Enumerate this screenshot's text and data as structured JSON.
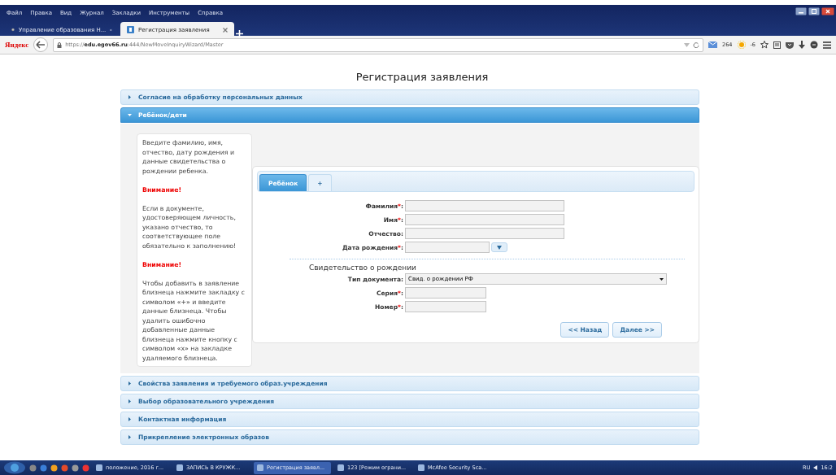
{
  "browser": {
    "menu": [
      "Файл",
      "Правка",
      "Вид",
      "Журнал",
      "Закладки",
      "Инструменты",
      "Справка"
    ],
    "tabs": [
      {
        "label": "Управление образования Н...",
        "selected": false
      },
      {
        "label": "Регистрация заявления",
        "selected": true
      }
    ],
    "brand": "Яндекс",
    "url": "https://**edu.egov66.ru**:444/NewMoveInquiryWizard/Master",
    "mail_count": "264",
    "weather": "-6"
  },
  "page": {
    "title": "Регистрация заявления",
    "sections": [
      {
        "title": "Согласие на обработку персональных данных",
        "expanded": false
      },
      {
        "title": "Ребёнок/дети",
        "expanded": true
      },
      {
        "title": "Свойства заявления и требуемого образ.учреждения",
        "expanded": false
      },
      {
        "title": "Выбор образовательного учреждения",
        "expanded": false
      },
      {
        "title": "Контактная информация",
        "expanded": false
      },
      {
        "title": "Прикрепление электронных образов",
        "expanded": false
      }
    ],
    "hint": [
      {
        "kind": "text",
        "text": "Введите фамилию, имя, отчество, дату рождения и данные свидетельства о рождении ребенка."
      },
      {
        "kind": "warning",
        "text": "Внимание!"
      },
      {
        "kind": "text",
        "text": "Если в документе, удостоверяющем личность, указано отчество, то соответствующее поле обязательно к заполнению!"
      },
      {
        "kind": "warning",
        "text": "Внимание!"
      },
      {
        "kind": "text",
        "text": "Чтобы добавить в заявление близнеца нажмите закладку с символом «+» и введите данные близнеца. Чтобы удалить ошибочно добавленные данные близнеца нажмите кнопку с символом «x» на закладке удаляемого близнеца."
      }
    ],
    "child_tabs": [
      {
        "label": "Ребёнок",
        "selected": true
      },
      {
        "label": "+",
        "selected": false
      }
    ],
    "required_mark": "*",
    "separator": ":",
    "fields": [
      {
        "label": "Фамилия",
        "required": true,
        "kind": "text"
      },
      {
        "label": "Имя",
        "required": true,
        "kind": "text"
      },
      {
        "label": "Отчество",
        "required": false,
        "kind": "text"
      },
      {
        "label": "Дата рождения",
        "required": true,
        "kind": "date"
      }
    ],
    "certificate": {
      "title": "Свидетельство о рождении",
      "fields": [
        {
          "label": "Тип документа",
          "required": false,
          "kind": "select",
          "value": "Свид. о рождении РФ"
        },
        {
          "label": "Серия",
          "required": true,
          "kind": "short"
        },
        {
          "label": "Номер",
          "required": true,
          "kind": "short"
        }
      ]
    },
    "buttons": [
      "<< Назад",
      "Далее >>"
    ]
  },
  "taskbar": {
    "items": [
      {
        "label": "положение, 2016 г...",
        "selected": false
      },
      {
        "label": "ЗАПИСЬ В КРУЖК...",
        "selected": false
      },
      {
        "label": "Регистрация заявл...",
        "selected": true
      },
      {
        "label": "123 [Режим ограни...",
        "selected": false
      },
      {
        "label": "McAfee Security Sca...",
        "selected": false
      }
    ],
    "language": "RU",
    "time": "16:2"
  }
}
